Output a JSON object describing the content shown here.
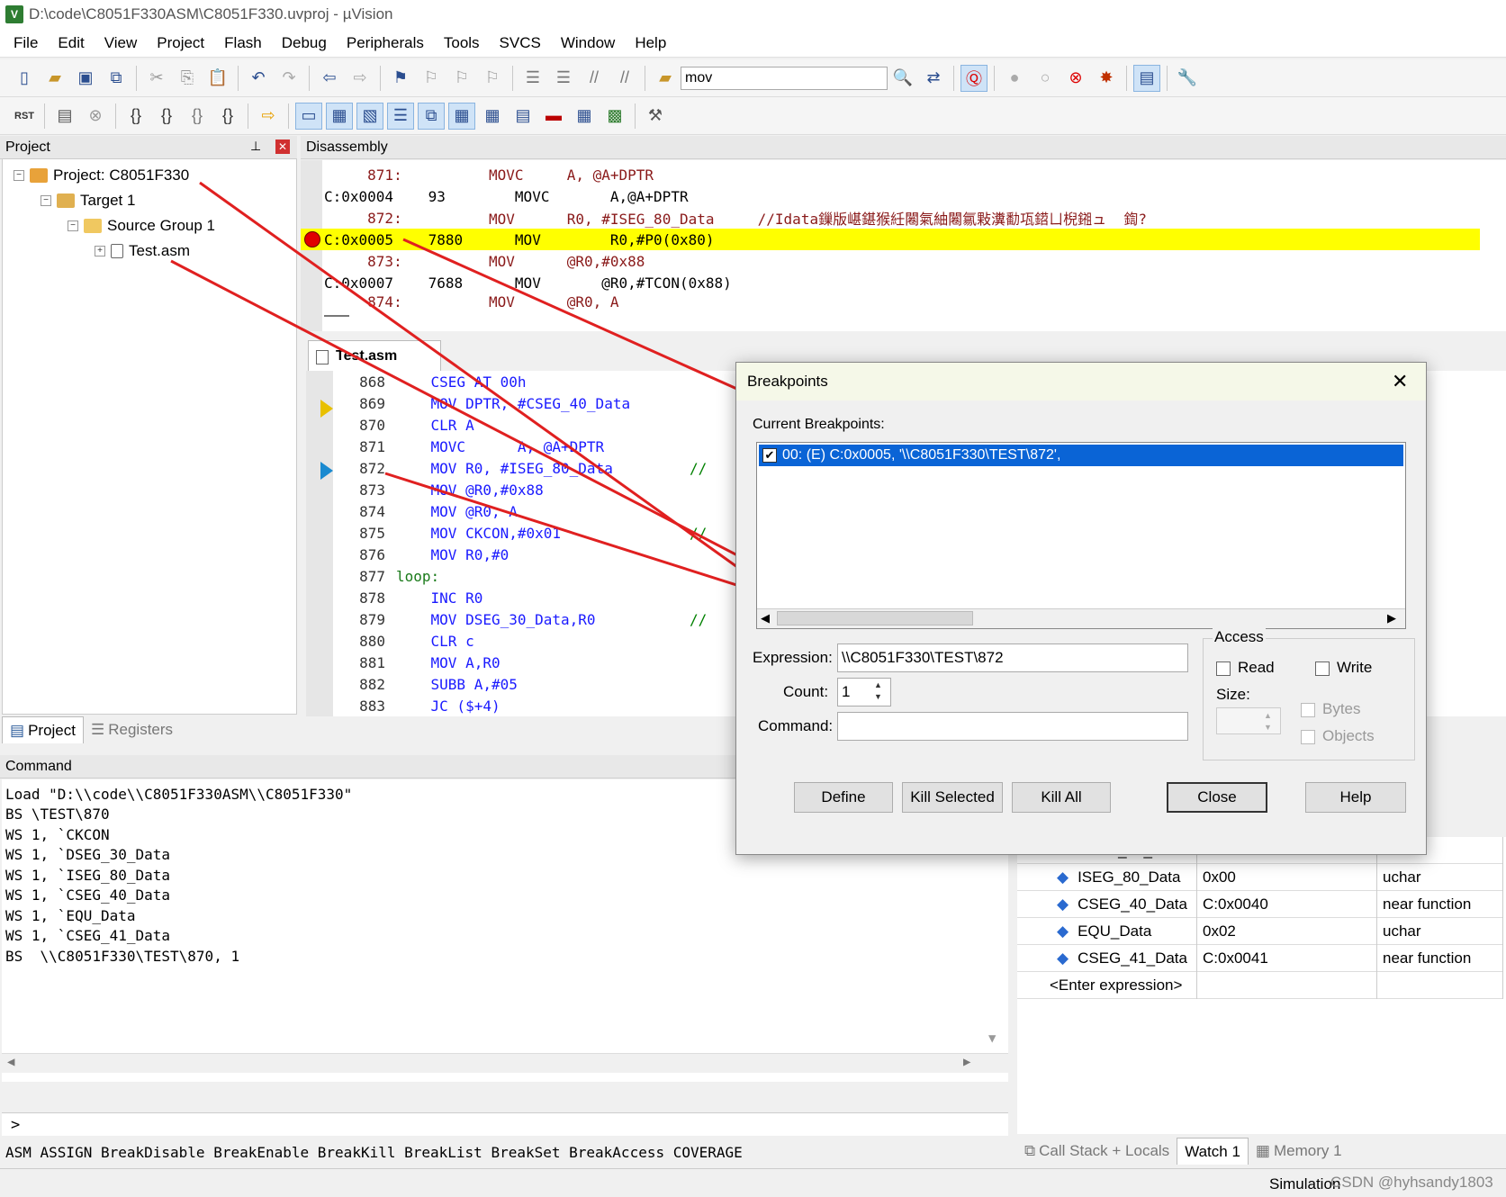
{
  "window": {
    "title": "D:\\code\\C8051F330ASM\\C8051F330.uvproj - µVision",
    "app_icon": "V"
  },
  "menu": [
    "File",
    "Edit",
    "View",
    "Project",
    "Flash",
    "Debug",
    "Peripherals",
    "Tools",
    "SVCS",
    "Window",
    "Help"
  ],
  "toolbar": {
    "find_value": "mov",
    "rst_label": "RST"
  },
  "project_panel": {
    "title": "Project",
    "tree": {
      "project": "Project: C8051F330",
      "target": "Target 1",
      "group": "Source Group 1",
      "file": "Test.asm"
    },
    "tabs": [
      "Project",
      "Registers"
    ]
  },
  "disassembly": {
    "title": "Disassembly",
    "lines": [
      {
        "a": "     871:",
        "b": "          MOVC     A, @A+DPTR"
      },
      {
        "a": "C:0x0004",
        "b": "    93        MOVC       A,@A+DPTR"
      },
      {
        "a": "     872:",
        "b": "          MOV      R0, #ISEG_80_Data     //Idata鏁版嵁鍖猴紝闂氣紬闂氱敤瀵勫瓨鍣ㄩ棿鎺ュ  鍧?"
      },
      {
        "a": "C:0x0005",
        "b": "    7880      MOV        R0,#P0(0x80)"
      },
      {
        "a": "     873:",
        "b": "          MOV      @R0,#0x88"
      },
      {
        "a": "C:0x0007",
        "b": "    7688      MOV       @R0,#TCON(0x88)"
      },
      {
        "a": "     874:",
        "b": "          MOV      @R0, A"
      }
    ]
  },
  "editor": {
    "tab": "Test.asm",
    "lines": [
      {
        "n": "868",
        "code": "    CSEG AT 00h",
        "cm": ""
      },
      {
        "n": "869",
        "code": "    MOV DPTR, #CSEG_40_Data",
        "cm": ""
      },
      {
        "n": "870",
        "code": "    CLR A",
        "cm": ""
      },
      {
        "n": "871",
        "code": "    MOVC      A, @A+DPTR",
        "cm": ""
      },
      {
        "n": "872",
        "code": "    MOV R0, #ISEG_80_Data",
        "cm": "//"
      },
      {
        "n": "873",
        "code": "    MOV @R0,#0x88",
        "cm": ""
      },
      {
        "n": "874",
        "code": "    MOV @R0, A",
        "cm": ""
      },
      {
        "n": "875",
        "code": "    MOV CKCON,#0x01",
        "cm": "//"
      },
      {
        "n": "876",
        "code": "    MOV R0,#0",
        "cm": ""
      },
      {
        "n": "877",
        "code": "loop:",
        "cm": ""
      },
      {
        "n": "878",
        "code": "    INC R0",
        "cm": ""
      },
      {
        "n": "879",
        "code": "    MOV DSEG_30_Data,R0",
        "cm": "//"
      },
      {
        "n": "880",
        "code": "    CLR c",
        "cm": ""
      },
      {
        "n": "881",
        "code": "    MOV A,R0",
        "cm": ""
      },
      {
        "n": "882",
        "code": "    SUBB A,#05",
        "cm": ""
      },
      {
        "n": "883",
        "code": "    JC ($+4)",
        "cm": ""
      }
    ]
  },
  "command": {
    "title": "Command",
    "output": [
      "Load \"D:\\\\code\\\\C8051F330ASM\\\\C8051F330\"",
      "BS \\TEST\\870",
      "WS 1, `CKCON",
      "WS 1, `DSEG_30_Data",
      "WS 1, `ISEG_80_Data",
      "WS 1, `CSEG_40_Data",
      "WS 1, `EQU_Data",
      "WS 1, `CSEG_41_Data",
      "BS  \\\\C8051F330\\TEST\\870, 1"
    ],
    "prompt": ">",
    "hints": "ASM ASSIGN BreakDisable BreakEnable BreakKill BreakList BreakSet BreakAccess COVERAGE"
  },
  "watch": {
    "rows": [
      {
        "name": "DSEG_30_Data",
        "value": "0x00",
        "type": "uchar"
      },
      {
        "name": "ISEG_80_Data",
        "value": "0x00",
        "type": "uchar"
      },
      {
        "name": "CSEG_40_Data",
        "value": "C:0x0040",
        "type": "near function"
      },
      {
        "name": "EQU_Data",
        "value": "0x02",
        "type": "uchar"
      },
      {
        "name": "CSEG_41_Data",
        "value": "C:0x0041",
        "type": "near function"
      }
    ],
    "enter": "<Enter expression>",
    "tabs": [
      "Call Stack + Locals",
      "Watch 1",
      "Memory 1"
    ]
  },
  "status": {
    "mode": "Simulation",
    "watermark": "CSDN @hyhsandy1803"
  },
  "dialog": {
    "title": "Breakpoints",
    "current_label": "Current Breakpoints:",
    "entry": "00: (E) C:0x0005,  '\\\\C8051F330\\TEST\\872',",
    "expression_label": "Expression:",
    "expression_value": "\\\\C8051F330\\TEST\\872",
    "count_label": "Count:",
    "count_value": "1",
    "command_label": "Command:",
    "access_title": "Access",
    "read": "Read",
    "write": "Write",
    "size_label": "Size:",
    "bytes": "Bytes",
    "objects": "Objects",
    "buttons": [
      "Define",
      "Kill Selected",
      "Kill All",
      "Close",
      "Help"
    ]
  },
  "colors": {
    "highlight": "#ffff00",
    "selection": "#0a64d6",
    "arrow": "#e02020",
    "breakpoint": "#e00000"
  }
}
